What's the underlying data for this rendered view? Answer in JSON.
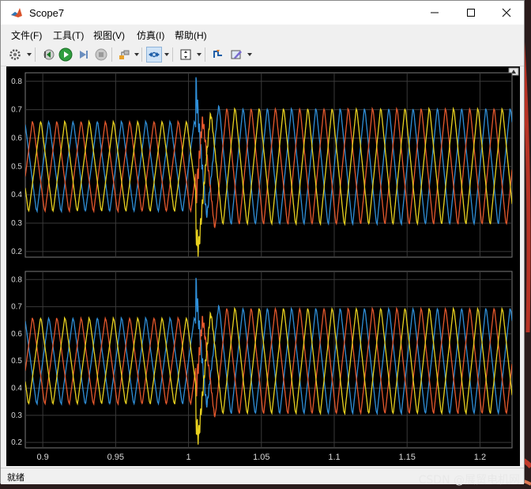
{
  "window": {
    "title": "Scope7",
    "minimize_icon": "minimize-icon",
    "maximize_icon": "maximize-icon",
    "close_icon": "close-icon"
  },
  "menu": {
    "items": [
      {
        "label": "文件(F)"
      },
      {
        "label": "工具(T)"
      },
      {
        "label": "视图(V)"
      },
      {
        "label": "仿真(I)"
      },
      {
        "label": "帮助(H)"
      }
    ]
  },
  "toolbar": {
    "icons": [
      "settings-icon",
      "step-back-icon",
      "run-icon",
      "step-forward-icon",
      "stop-icon",
      "highlight-icon",
      "zoom-x-icon",
      "autoscale-icon",
      "triggers-icon",
      "style-icon"
    ]
  },
  "status": {
    "text": "就绪",
    "watermark": "CSDN @展贸电机网"
  },
  "colors": {
    "phase_a": "#2f8fd8",
    "phase_b": "#e5582c",
    "phase_c": "#e8d11f",
    "grid": "#3a3a3a",
    "axes_bg": "#000000"
  },
  "chart_data": [
    {
      "type": "line",
      "xlim": [
        0.888,
        1.222
      ],
      "ylim": [
        0.18,
        0.83
      ],
      "yticks": [
        "0.8",
        "0.7",
        "0.6",
        "0.5",
        "0.4",
        "0.3",
        "0.2"
      ],
      "ytick_values": [
        0.8,
        0.7,
        0.6,
        0.5,
        0.4,
        0.3,
        0.2
      ],
      "xtick_values": [
        0.9,
        0.95,
        1.0,
        1.05,
        1.1,
        1.15,
        1.2
      ],
      "grid": true,
      "disturbance_time": 1.005,
      "series": [
        {
          "color": "#2f8fd8",
          "before_low": 0.345,
          "before_high": 0.655,
          "after_low": 0.3,
          "after_high": 0.7,
          "phase": 0.0
        },
        {
          "color": "#e5582c",
          "before_low": 0.345,
          "before_high": 0.655,
          "after_low": 0.3,
          "after_high": 0.7,
          "phase": 2.094
        },
        {
          "color": "#e8d11f",
          "before_low": 0.345,
          "before_high": 0.655,
          "after_low": 0.3,
          "after_high": 0.7,
          "phase": 4.189
        }
      ]
    },
    {
      "type": "line",
      "xlim": [
        0.888,
        1.222
      ],
      "ylim": [
        0.18,
        0.83
      ],
      "yticks": [
        "0.8",
        "0.7",
        "0.6",
        "0.5",
        "0.4",
        "0.3",
        "0.2"
      ],
      "ytick_values": [
        0.8,
        0.7,
        0.6,
        0.5,
        0.4,
        0.3,
        0.2
      ],
      "xticks": [
        "0.9",
        "0.95",
        "1",
        "1.05",
        "1.1",
        "1.15",
        "1.2"
      ],
      "xtick_values": [
        0.9,
        0.95,
        1.0,
        1.05,
        1.1,
        1.15,
        1.2
      ],
      "grid": true,
      "disturbance_time": 1.005,
      "series": [
        {
          "color": "#2f8fd8",
          "before_low": 0.345,
          "before_high": 0.655,
          "after_low": 0.31,
          "after_high": 0.69,
          "phase": 0.0
        },
        {
          "color": "#e5582c",
          "before_low": 0.345,
          "before_high": 0.655,
          "after_low": 0.31,
          "after_high": 0.69,
          "phase": 2.094
        },
        {
          "color": "#e8d11f",
          "before_low": 0.345,
          "before_high": 0.655,
          "after_low": 0.31,
          "after_high": 0.69,
          "phase": 4.189
        }
      ]
    }
  ]
}
